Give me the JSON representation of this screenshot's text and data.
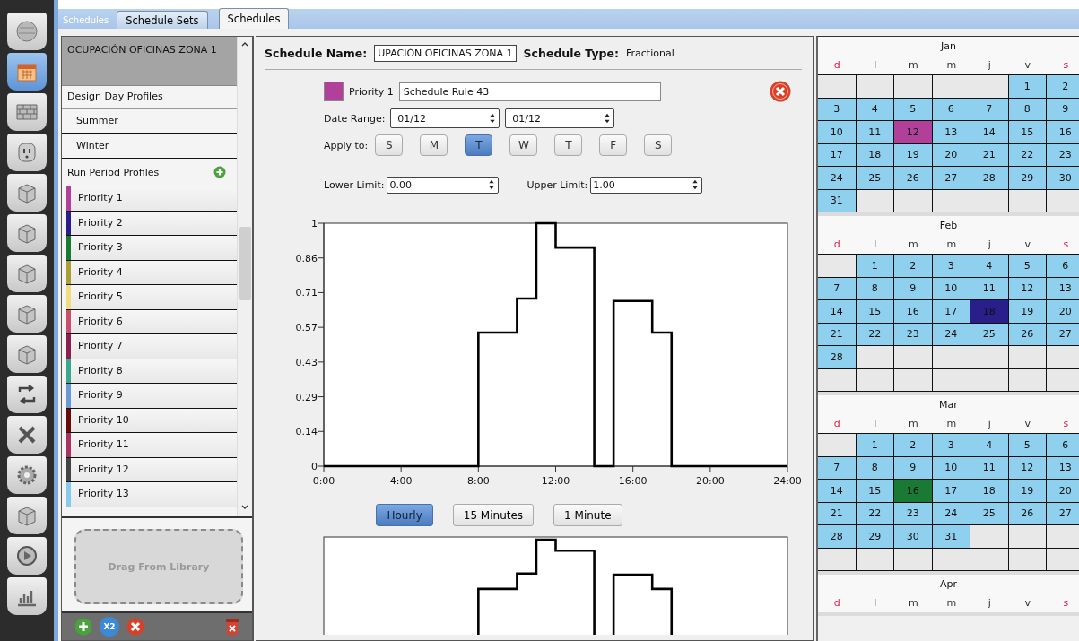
{
  "nav_items": [
    {
      "selected": false
    },
    {
      "selected": true
    },
    {
      "selected": false
    },
    {
      "selected": false
    },
    {
      "selected": false
    },
    {
      "selected": false
    },
    {
      "selected": false
    },
    {
      "selected": false
    },
    {
      "selected": false
    },
    {
      "selected": false
    },
    {
      "selected": false
    },
    {
      "selected": false
    },
    {
      "selected": false
    },
    {
      "selected": false
    },
    {
      "selected": false
    }
  ],
  "header_label": "Schedules",
  "tabs": [
    {
      "label": "Schedule Sets",
      "selected": false
    },
    {
      "label": "Schedules",
      "selected": true
    }
  ],
  "schedule_list": {
    "title": "OCUPACIÓN OFICINAS ZONA 1",
    "design_day_heading": "Design Day Profiles",
    "design_days": [
      "Summer",
      "Winter"
    ],
    "run_period_heading": "Run Period Profiles",
    "priorities": [
      {
        "label": "Priority 1",
        "color": "#b0409a"
      },
      {
        "label": "Priority 2",
        "color": "#2a1f8a"
      },
      {
        "label": "Priority 3",
        "color": "#1a7a34"
      },
      {
        "label": "Priority 4",
        "color": "#a8a032"
      },
      {
        "label": "Priority 5",
        "color": "#eede80"
      },
      {
        "label": "Priority 6",
        "color": "#c8506e"
      },
      {
        "label": "Priority 7",
        "color": "#8a2050"
      },
      {
        "label": "Priority 8",
        "color": "#3aa890"
      },
      {
        "label": "Priority 9",
        "color": "#6a9ad6"
      },
      {
        "label": "Priority 10",
        "color": "#6a0a0a"
      },
      {
        "label": "Priority 11",
        "color": "#a83262"
      },
      {
        "label": "Priority 12",
        "color": "#444444"
      },
      {
        "label": "Priority 13",
        "color": "#86cbea"
      }
    ],
    "drop_zone": "Drag From Library",
    "duplicate_label": "X2"
  },
  "schedule": {
    "name_label": "Schedule Name:",
    "name": "UPACIÓN OFICINAS ZONA 1",
    "type_label": "Schedule Type:",
    "type": "Fractional",
    "rule": {
      "priority": "Priority 1",
      "color": "#b0409a",
      "name": "Schedule Rule 43",
      "date_range_label": "Date Range:",
      "start": "01/12",
      "end": "01/12",
      "apply_label": "Apply to:",
      "days": [
        {
          "label": "S",
          "selected": false
        },
        {
          "label": "M",
          "selected": false
        },
        {
          "label": "T",
          "selected": true
        },
        {
          "label": "W",
          "selected": false
        },
        {
          "label": "T",
          "selected": false
        },
        {
          "label": "F",
          "selected": false
        },
        {
          "label": "S",
          "selected": false
        }
      ],
      "lower_label": "Lower Limit:",
      "lower": "0.00",
      "upper_label": "Upper Limit:",
      "upper": "1.00"
    },
    "chart_data": {
      "type": "line",
      "x": [
        0,
        8,
        8,
        10,
        10,
        11,
        11,
        12,
        12,
        14,
        14,
        15,
        15,
        17,
        17,
        18,
        18,
        24
      ],
      "series": [
        {
          "values": [
            0,
            0,
            0.55,
            0.55,
            0.69,
            0.69,
            1,
            1,
            0.9,
            0.9,
            0,
            0,
            0.68,
            0.68,
            0.55,
            0.55,
            0,
            0
          ]
        }
      ],
      "xlim": [
        0,
        24
      ],
      "ylim": [
        0,
        1
      ],
      "xticks": [
        {
          "value": 0,
          "label": "0:00"
        },
        {
          "value": 4,
          "label": "4:00"
        },
        {
          "value": 8,
          "label": "8:00"
        },
        {
          "value": 12,
          "label": "12:00"
        },
        {
          "value": 16,
          "label": "16:00"
        },
        {
          "value": 20,
          "label": "20:00"
        },
        {
          "value": 24,
          "label": "24:00"
        }
      ],
      "yticks": [
        {
          "value": 0,
          "label": "0"
        },
        {
          "value": 0.1429,
          "label": "0.14"
        },
        {
          "value": 0.2857,
          "label": "0.29"
        },
        {
          "value": 0.4286,
          "label": "0.43"
        },
        {
          "value": 0.5714,
          "label": "0.57"
        },
        {
          "value": 0.7143,
          "label": "0.71"
        },
        {
          "value": 0.8571,
          "label": "0.86"
        },
        {
          "value": 1,
          "label": "1"
        }
      ]
    },
    "resolutions": [
      {
        "label": "Hourly",
        "selected": true
      },
      {
        "label": "15 Minutes",
        "selected": false
      },
      {
        "label": "1 Minute",
        "selected": false
      }
    ]
  },
  "calendar": [
    {
      "month": "Jan",
      "weekdays": [
        {
          "label": "d",
          "weekend": true
        },
        {
          "label": "l",
          "weekend": false
        },
        {
          "label": "m",
          "weekend": false
        },
        {
          "label": "m",
          "weekend": false
        },
        {
          "label": "j",
          "weekend": false
        },
        {
          "label": "v",
          "weekend": false
        },
        {
          "label": "s",
          "weekend": true
        }
      ],
      "weeks": [
        [
          {
            "kind": "blank"
          },
          {
            "kind": "blank"
          },
          {
            "kind": "blank"
          },
          {
            "kind": "blank"
          },
          {
            "kind": "blank"
          },
          {
            "kind": "day",
            "day": "1"
          },
          {
            "kind": "day",
            "day": "2"
          }
        ],
        [
          {
            "kind": "day",
            "day": "3"
          },
          {
            "kind": "day",
            "day": "4"
          },
          {
            "kind": "day",
            "day": "5"
          },
          {
            "kind": "day",
            "day": "6"
          },
          {
            "kind": "day",
            "day": "7"
          },
          {
            "kind": "day",
            "day": "8"
          },
          {
            "kind": "day",
            "day": "9"
          }
        ],
        [
          {
            "kind": "day",
            "day": "10"
          },
          {
            "kind": "day",
            "day": "11"
          },
          {
            "kind": "day",
            "day": "12",
            "color": "#b0409a"
          },
          {
            "kind": "day",
            "day": "13"
          },
          {
            "kind": "day",
            "day": "14"
          },
          {
            "kind": "day",
            "day": "15"
          },
          {
            "kind": "day",
            "day": "16"
          }
        ],
        [
          {
            "kind": "day",
            "day": "17"
          },
          {
            "kind": "day",
            "day": "18"
          },
          {
            "kind": "day",
            "day": "19"
          },
          {
            "kind": "day",
            "day": "20"
          },
          {
            "kind": "day",
            "day": "21"
          },
          {
            "kind": "day",
            "day": "22"
          },
          {
            "kind": "day",
            "day": "23"
          }
        ],
        [
          {
            "kind": "day",
            "day": "24"
          },
          {
            "kind": "day",
            "day": "25"
          },
          {
            "kind": "day",
            "day": "26"
          },
          {
            "kind": "day",
            "day": "27"
          },
          {
            "kind": "day",
            "day": "28"
          },
          {
            "kind": "day",
            "day": "29"
          },
          {
            "kind": "day",
            "day": "30"
          }
        ],
        [
          {
            "kind": "day",
            "day": "31"
          },
          {
            "kind": "blank"
          },
          {
            "kind": "blank"
          },
          {
            "kind": "blank"
          },
          {
            "kind": "blank"
          },
          {
            "kind": "blank"
          },
          {
            "kind": "blank"
          }
        ]
      ]
    },
    {
      "month": "Feb",
      "weekdays": [
        {
          "label": "d",
          "weekend": true
        },
        {
          "label": "l",
          "weekend": false
        },
        {
          "label": "m",
          "weekend": false
        },
        {
          "label": "m",
          "weekend": false
        },
        {
          "label": "j",
          "weekend": false
        },
        {
          "label": "v",
          "weekend": false
        },
        {
          "label": "s",
          "weekend": true
        }
      ],
      "weeks": [
        [
          {
            "kind": "blank"
          },
          {
            "kind": "day",
            "day": "1"
          },
          {
            "kind": "day",
            "day": "2"
          },
          {
            "kind": "day",
            "day": "3"
          },
          {
            "kind": "day",
            "day": "4"
          },
          {
            "kind": "day",
            "day": "5"
          },
          {
            "kind": "day",
            "day": "6"
          }
        ],
        [
          {
            "kind": "day",
            "day": "7"
          },
          {
            "kind": "day",
            "day": "8"
          },
          {
            "kind": "day",
            "day": "9"
          },
          {
            "kind": "day",
            "day": "10"
          },
          {
            "kind": "day",
            "day": "11"
          },
          {
            "kind": "day",
            "day": "12"
          },
          {
            "kind": "day",
            "day": "13"
          }
        ],
        [
          {
            "kind": "day",
            "day": "14"
          },
          {
            "kind": "day",
            "day": "15"
          },
          {
            "kind": "day",
            "day": "16"
          },
          {
            "kind": "day",
            "day": "17"
          },
          {
            "kind": "day",
            "day": "18",
            "color": "#2a1f8a"
          },
          {
            "kind": "day",
            "day": "19"
          },
          {
            "kind": "day",
            "day": "20"
          }
        ],
        [
          {
            "kind": "day",
            "day": "21"
          },
          {
            "kind": "day",
            "day": "22"
          },
          {
            "kind": "day",
            "day": "23"
          },
          {
            "kind": "day",
            "day": "24"
          },
          {
            "kind": "day",
            "day": "25"
          },
          {
            "kind": "day",
            "day": "26"
          },
          {
            "kind": "day",
            "day": "27"
          }
        ],
        [
          {
            "kind": "day",
            "day": "28"
          },
          {
            "kind": "blank"
          },
          {
            "kind": "blank"
          },
          {
            "kind": "blank"
          },
          {
            "kind": "blank"
          },
          {
            "kind": "blank"
          },
          {
            "kind": "blank"
          }
        ],
        [
          {
            "kind": "blank"
          },
          {
            "kind": "blank"
          },
          {
            "kind": "blank"
          },
          {
            "kind": "blank"
          },
          {
            "kind": "blank"
          },
          {
            "kind": "blank"
          },
          {
            "kind": "blank"
          }
        ]
      ]
    },
    {
      "month": "Mar",
      "weekdays": [
        {
          "label": "d",
          "weekend": true
        },
        {
          "label": "l",
          "weekend": false
        },
        {
          "label": "m",
          "weekend": false
        },
        {
          "label": "m",
          "weekend": false
        },
        {
          "label": "j",
          "weekend": false
        },
        {
          "label": "v",
          "weekend": false
        },
        {
          "label": "s",
          "weekend": true
        }
      ],
      "weeks": [
        [
          {
            "kind": "blank"
          },
          {
            "kind": "day",
            "day": "1"
          },
          {
            "kind": "day",
            "day": "2"
          },
          {
            "kind": "day",
            "day": "3"
          },
          {
            "kind": "day",
            "day": "4"
          },
          {
            "kind": "day",
            "day": "5"
          },
          {
            "kind": "day",
            "day": "6"
          }
        ],
        [
          {
            "kind": "day",
            "day": "7"
          },
          {
            "kind": "day",
            "day": "8"
          },
          {
            "kind": "day",
            "day": "9"
          },
          {
            "kind": "day",
            "day": "10"
          },
          {
            "kind": "day",
            "day": "11"
          },
          {
            "kind": "day",
            "day": "12"
          },
          {
            "kind": "day",
            "day": "13"
          }
        ],
        [
          {
            "kind": "day",
            "day": "14"
          },
          {
            "kind": "day",
            "day": "15"
          },
          {
            "kind": "day",
            "day": "16",
            "color": "#1a7a34"
          },
          {
            "kind": "day",
            "day": "17"
          },
          {
            "kind": "day",
            "day": "18"
          },
          {
            "kind": "day",
            "day": "19"
          },
          {
            "kind": "day",
            "day": "20"
          }
        ],
        [
          {
            "kind": "day",
            "day": "21"
          },
          {
            "kind": "day",
            "day": "22"
          },
          {
            "kind": "day",
            "day": "23"
          },
          {
            "kind": "day",
            "day": "24"
          },
          {
            "kind": "day",
            "day": "25"
          },
          {
            "kind": "day",
            "day": "26"
          },
          {
            "kind": "day",
            "day": "27"
          }
        ],
        [
          {
            "kind": "day",
            "day": "28"
          },
          {
            "kind": "day",
            "day": "29"
          },
          {
            "kind": "day",
            "day": "30"
          },
          {
            "kind": "day",
            "day": "31"
          },
          {
            "kind": "blank"
          },
          {
            "kind": "blank"
          },
          {
            "kind": "blank"
          }
        ],
        [
          {
            "kind": "blank"
          },
          {
            "kind": "blank"
          },
          {
            "kind": "blank"
          },
          {
            "kind": "blank"
          },
          {
            "kind": "blank"
          },
          {
            "kind": "blank"
          },
          {
            "kind": "blank"
          }
        ]
      ]
    },
    {
      "month": "Apr",
      "weekdays": [
        {
          "label": "d",
          "weekend": true
        },
        {
          "label": "l",
          "weekend": false
        },
        {
          "label": "m",
          "weekend": false
        },
        {
          "label": "m",
          "weekend": false
        },
        {
          "label": "j",
          "weekend": false
        },
        {
          "label": "v",
          "weekend": false
        },
        {
          "label": "s",
          "weekend": true
        }
      ]
    }
  ]
}
